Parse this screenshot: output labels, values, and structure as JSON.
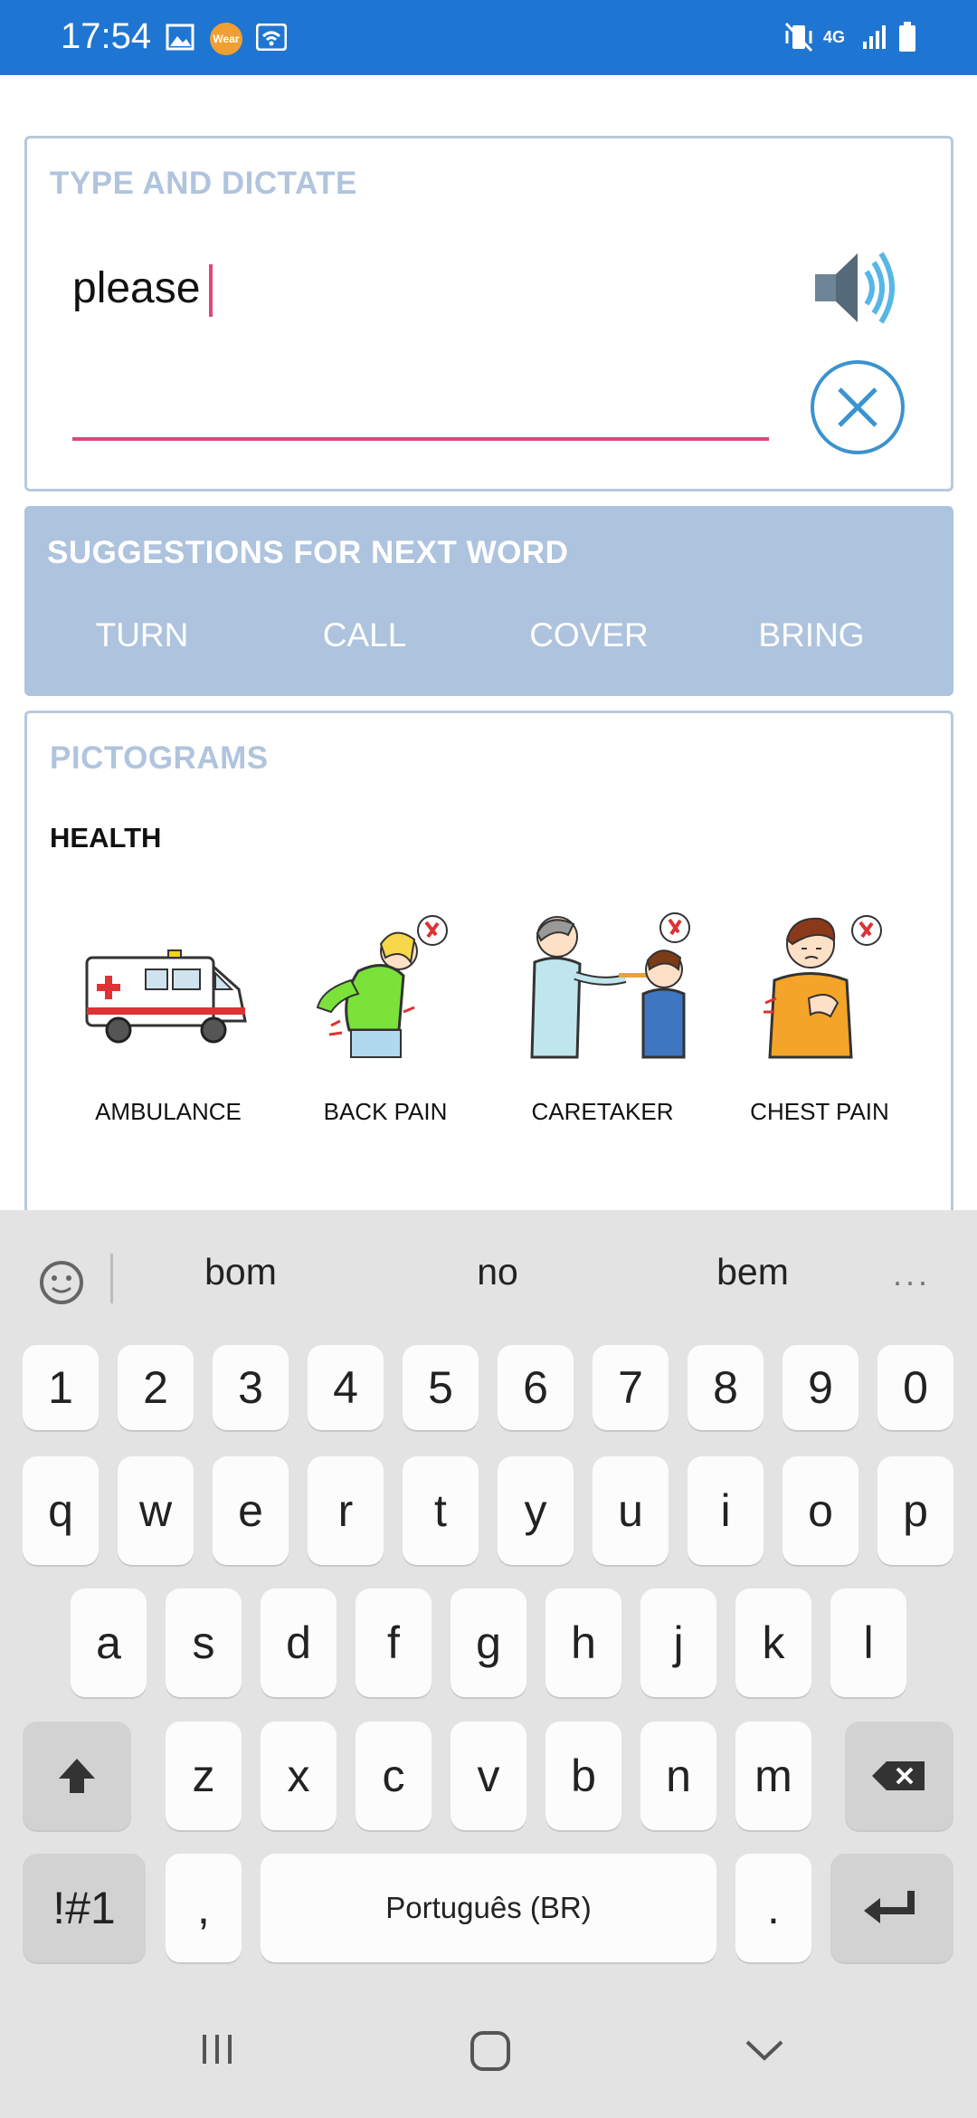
{
  "status_bar": {
    "time": "17:54",
    "wear_label": "Wear",
    "network": "4G"
  },
  "type_card": {
    "title": "TYPE AND DICTATE",
    "text": "please"
  },
  "suggestions": {
    "title": "SUGGESTIONS FOR NEXT WORD",
    "words": [
      "TURN",
      "CALL",
      "COVER",
      "BRING"
    ]
  },
  "pictograms": {
    "title": "PICTOGRAMS",
    "category": "HEALTH",
    "items": [
      {
        "label": "AMBULANCE",
        "icon": "ambulance-icon"
      },
      {
        "label": "BACK PAIN",
        "icon": "back-pain-icon"
      },
      {
        "label": "CARETAKER",
        "icon": "caretaker-icon"
      },
      {
        "label": "CHEST PAIN",
        "icon": "chest-pain-icon"
      }
    ]
  },
  "keyboard": {
    "predictions": [
      "bom",
      "no",
      "bem"
    ],
    "row_numbers": [
      "1",
      "2",
      "3",
      "4",
      "5",
      "6",
      "7",
      "8",
      "9",
      "0"
    ],
    "row1": [
      "q",
      "w",
      "e",
      "r",
      "t",
      "y",
      "u",
      "i",
      "o",
      "p"
    ],
    "row2": [
      "a",
      "s",
      "d",
      "f",
      "g",
      "h",
      "j",
      "k",
      "l"
    ],
    "row3": [
      "z",
      "x",
      "c",
      "v",
      "b",
      "n",
      "m"
    ],
    "symbols_key": "!#1",
    "comma_key": ",",
    "space_key": "Português (BR)",
    "period_key": "."
  },
  "colors": {
    "status_bar": "#1f76d2",
    "accent_pink": "#e2457a",
    "suggestion_bg": "#adc3de",
    "title_blue": "#b0c4de"
  }
}
